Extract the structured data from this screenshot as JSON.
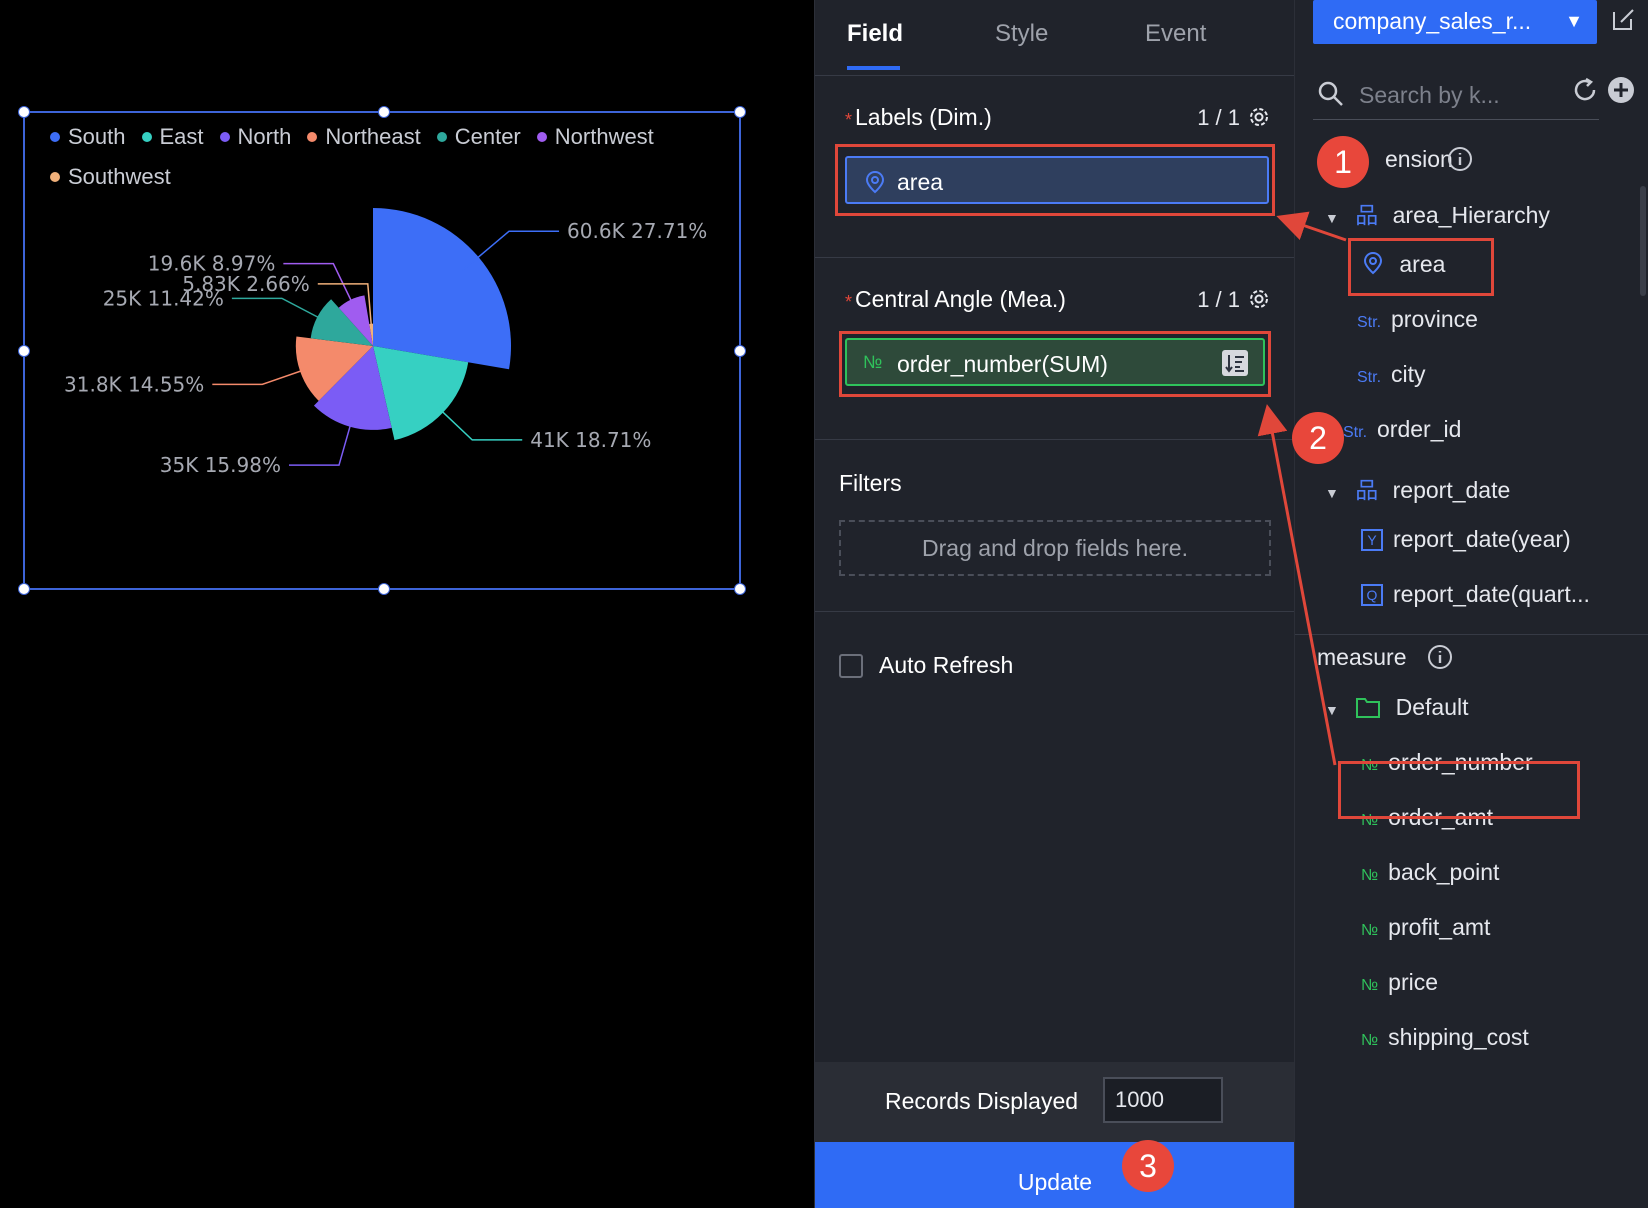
{
  "chart": {
    "legend": [
      {
        "name": "South",
        "color": "#3d6ef7"
      },
      {
        "name": "East",
        "color": "#36d0c2"
      },
      {
        "name": "North",
        "color": "#7b5cf5"
      },
      {
        "name": "Northeast",
        "color": "#f48a6b"
      },
      {
        "name": "Center",
        "color": "#2ea89c"
      },
      {
        "name": "Northwest",
        "color": "#a05cf0"
      },
      {
        "name": "Southwest",
        "color": "#f0b07a"
      }
    ]
  },
  "chart_data": {
    "type": "pie",
    "variant": "nightingale-rose",
    "categories": [
      "South",
      "East",
      "North",
      "Northeast",
      "Center",
      "Northwest",
      "Southwest"
    ],
    "values": [
      60600,
      41000,
      35000,
      31800,
      25000,
      19600,
      5830
    ],
    "labels": [
      "60.6K 27.71%",
      "41K 18.71%",
      "35K 15.98%",
      "31.8K 14.55%",
      "25K 11.42%",
      "19.6K 8.97%",
      "5.83K 2.66%"
    ],
    "percentages": [
      27.71,
      18.71,
      15.98,
      14.55,
      11.42,
      8.97,
      2.66
    ],
    "legend_position": "top-left"
  },
  "config": {
    "tabs": [
      "Field",
      "Style",
      "Event"
    ],
    "labels_section": {
      "title": "Labels (Dim.)",
      "count": "1 / 1",
      "field": "area"
    },
    "angle_section": {
      "title": "Central Angle (Mea.)",
      "count": "1 / 1",
      "field": "order_number(SUM)",
      "type_tag": "№"
    },
    "filters": {
      "title": "Filters",
      "placeholder": "Drag and drop fields here."
    },
    "auto_refresh": {
      "label": "Auto Refresh",
      "checked": false
    },
    "records": {
      "label": "Records Displayed",
      "value": "1000"
    },
    "update_label": "Update"
  },
  "dataset": {
    "name": "company_sales_r...",
    "search_placeholder": "Search by k...",
    "dimension_heading": "Dimension",
    "dimension_heading_visible": "ension",
    "dimension_items": [
      {
        "label": "area_Hierarchy",
        "tag": "hier"
      },
      {
        "label": "area",
        "tag": "geo"
      },
      {
        "label": "province",
        "tag": "Str."
      },
      {
        "label": "city",
        "tag": "Str."
      },
      {
        "label": "order_id",
        "tag": "Str."
      },
      {
        "label": "report_date",
        "tag": "hier"
      },
      {
        "label": "report_date(year)",
        "tag": "Y"
      },
      {
        "label": "report_date(quart...",
        "tag": "Q"
      }
    ],
    "measure_heading": "measure",
    "folder": "Default",
    "measure_items": [
      "order_number",
      "order_amt",
      "back_point",
      "profit_amt",
      "price",
      "shipping_cost"
    ],
    "num_tag": "№"
  },
  "steps": [
    "1",
    "2",
    "3"
  ]
}
